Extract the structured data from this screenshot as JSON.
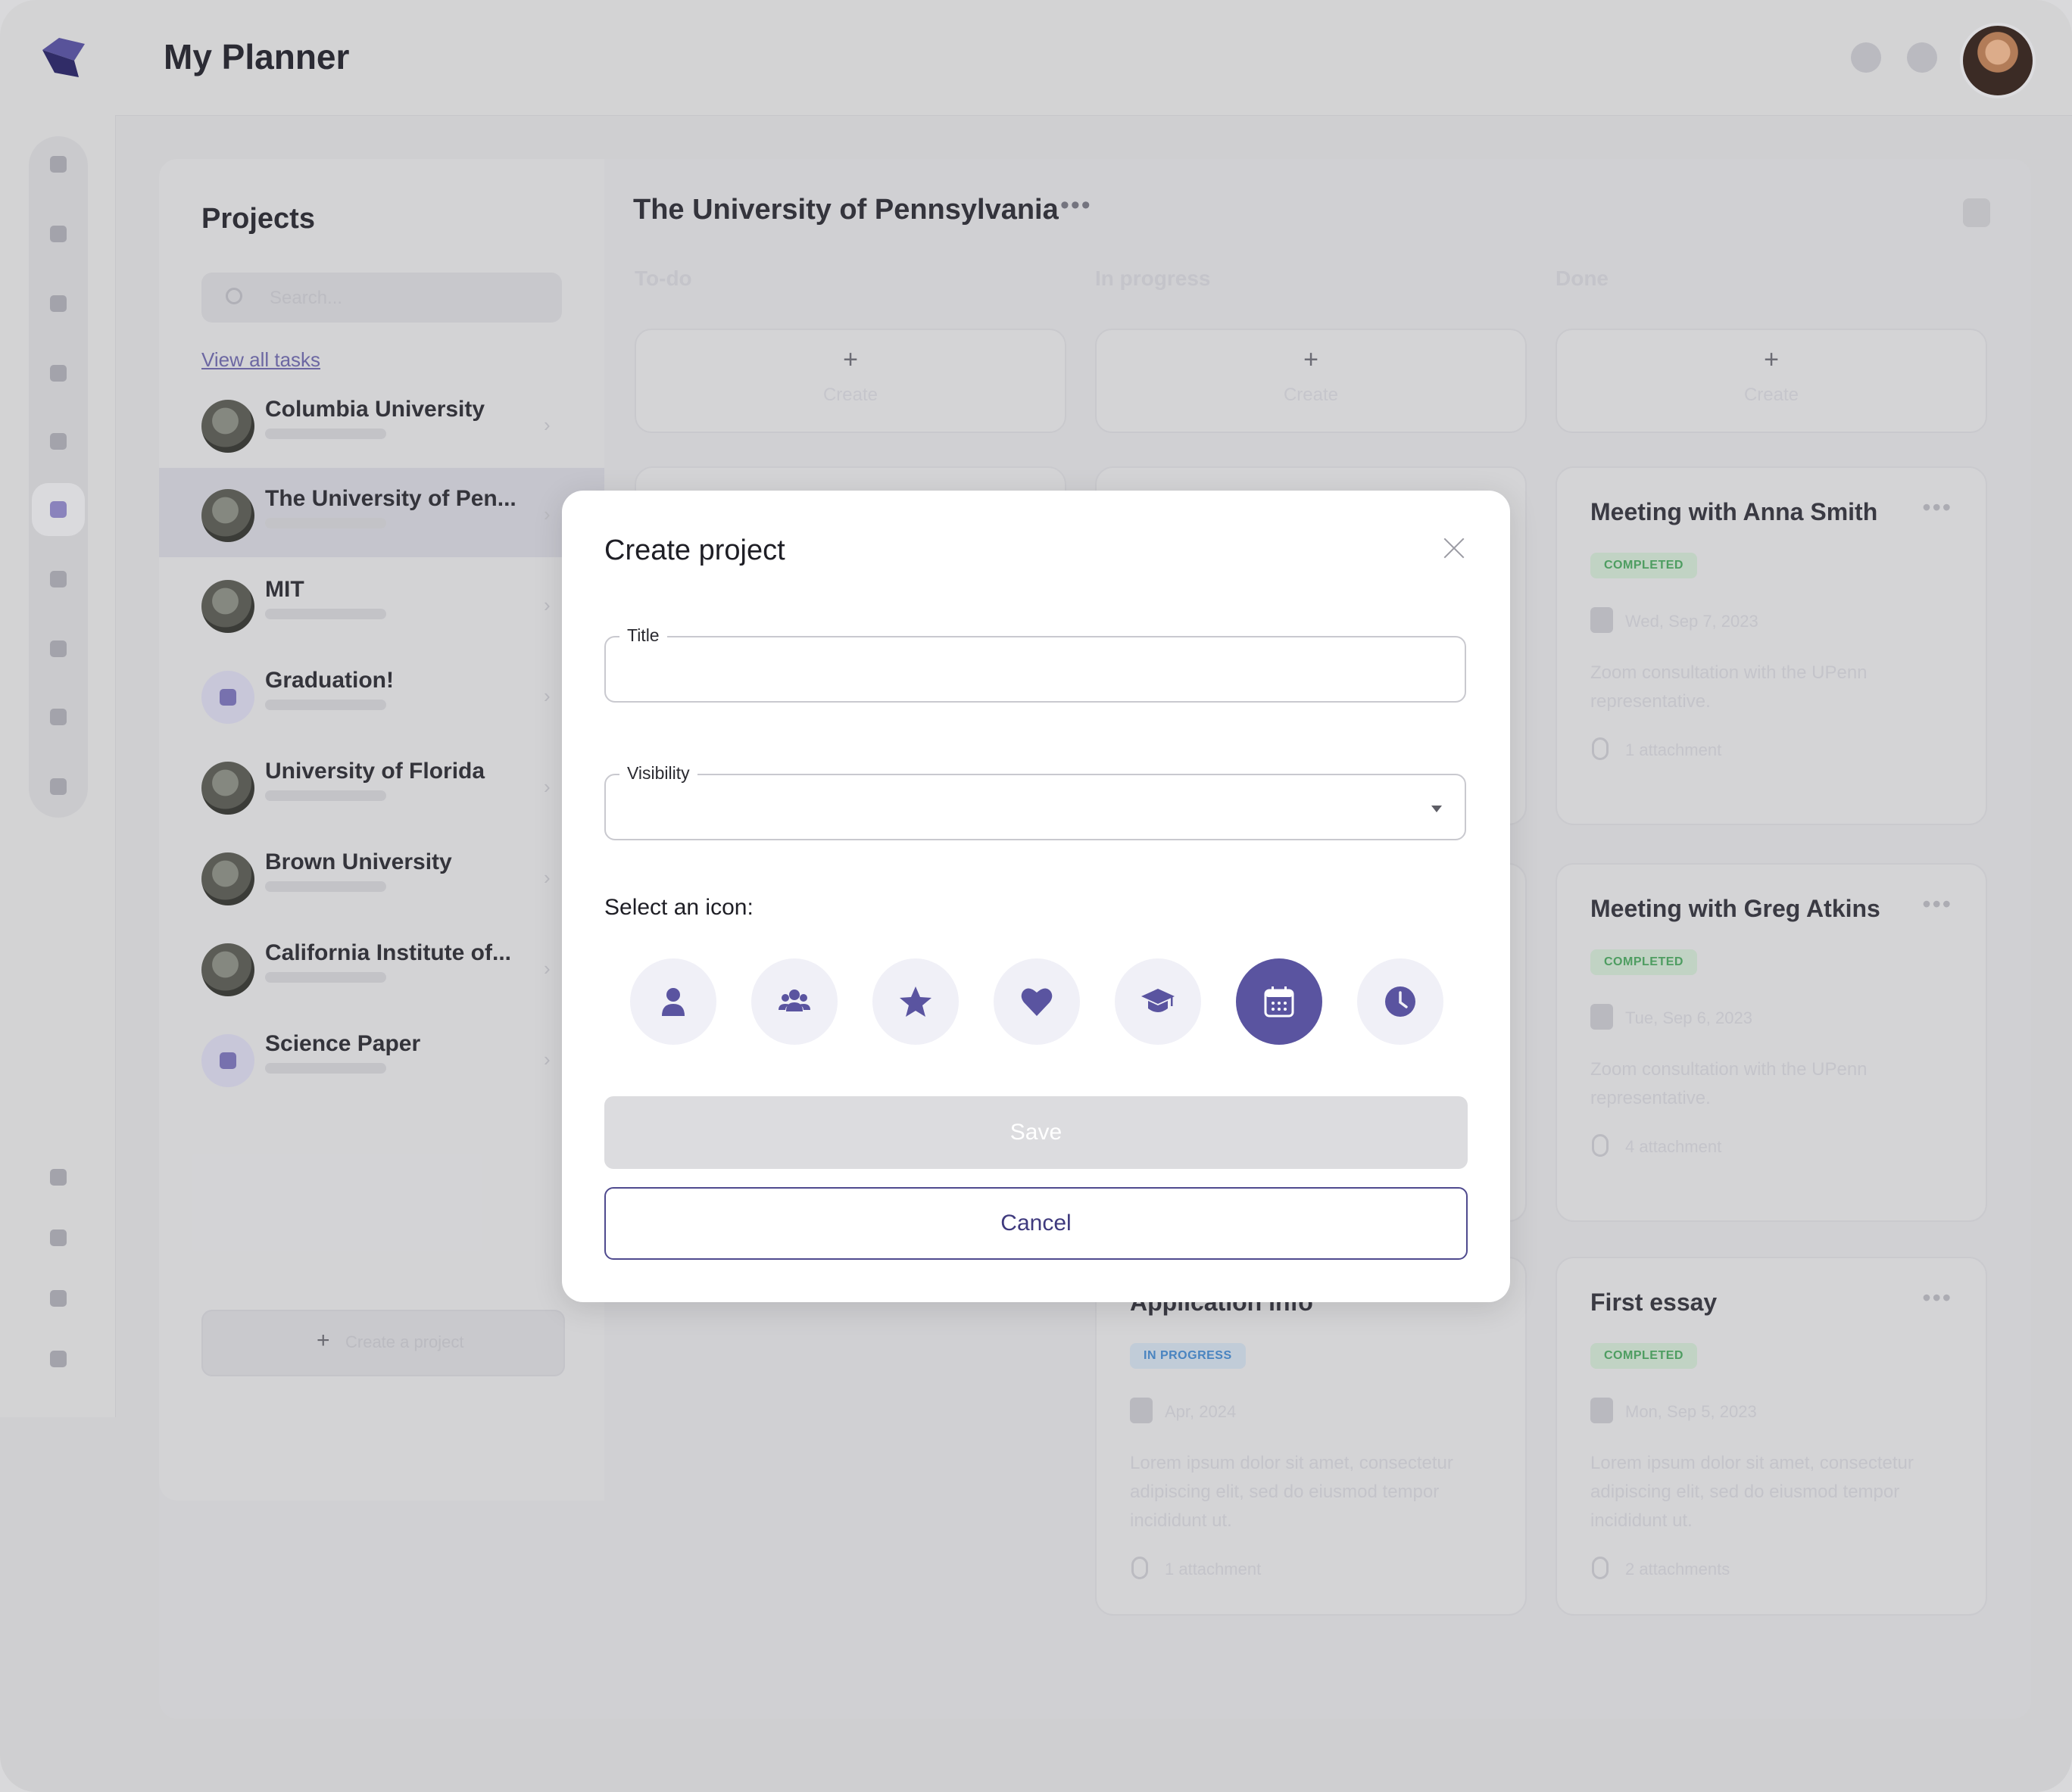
{
  "app": {
    "title": "My Planner"
  },
  "projects": {
    "title": "Projects",
    "search_placeholder": "Search...",
    "view_all": "View all tasks",
    "items": [
      {
        "name": "Columbia University",
        "selected": false
      },
      {
        "name": "The University of Pen...",
        "selected": true
      },
      {
        "name": "MIT",
        "selected": false
      },
      {
        "name": "Graduation!",
        "selected": false
      },
      {
        "name": "University of Florida",
        "selected": false
      },
      {
        "name": "Brown University",
        "selected": false
      },
      {
        "name": "California Institute of...",
        "selected": false
      },
      {
        "name": "Science Paper",
        "selected": false
      }
    ],
    "create_label": "Create a project"
  },
  "board": {
    "title": "The University of Pennsylvania",
    "columns": [
      "To-do",
      "In progress",
      "Done"
    ],
    "create_label": "Create",
    "cards": [
      {
        "title": "Meeting with Anna Smith",
        "badge": "COMPLETED",
        "date": "Wed, Sep 7, 2023",
        "desc": "Zoom consultation with the UPenn representative.",
        "attach": "1 attachment"
      },
      {
        "title": "Meeting with Greg Atkins",
        "badge": "COMPLETED",
        "date": "Tue, Sep 6, 2023",
        "desc": "Zoom consultation with the UPenn representative.",
        "attach": "4 attachment"
      },
      {
        "title": "Application info",
        "badge": "IN PROGRESS",
        "date": "Apr, 2024",
        "desc": "Lorem ipsum dolor sit amet, consectetur adipiscing elit, sed do eiusmod tempor incididunt ut.",
        "attach": "1 attachment"
      },
      {
        "title": "First essay",
        "badge": "COMPLETED",
        "date": "Mon, Sep 5, 2023",
        "desc": "Lorem ipsum dolor sit amet, consectetur adipiscing elit, sed do eiusmod tempor incididunt ut.",
        "attach": "2 attachments"
      }
    ]
  },
  "modal": {
    "title": "Create project",
    "title_field_label": "Title",
    "title_field_value": "",
    "visibility_label": "Visibility",
    "visibility_value": "",
    "icon_prompt": "Select an icon:",
    "icons": [
      "person-icon",
      "group-icon",
      "star-icon",
      "heart-icon",
      "graduation-cap-icon",
      "calendar-icon",
      "clock-icon"
    ],
    "selected_icon": "calendar-icon",
    "save_label": "Save",
    "cancel_label": "Cancel"
  },
  "colors": {
    "accent": "#5a54a0",
    "accent_light": "#f0f0f7",
    "completed": "#4fa363",
    "in_progress": "#4a88c8"
  }
}
